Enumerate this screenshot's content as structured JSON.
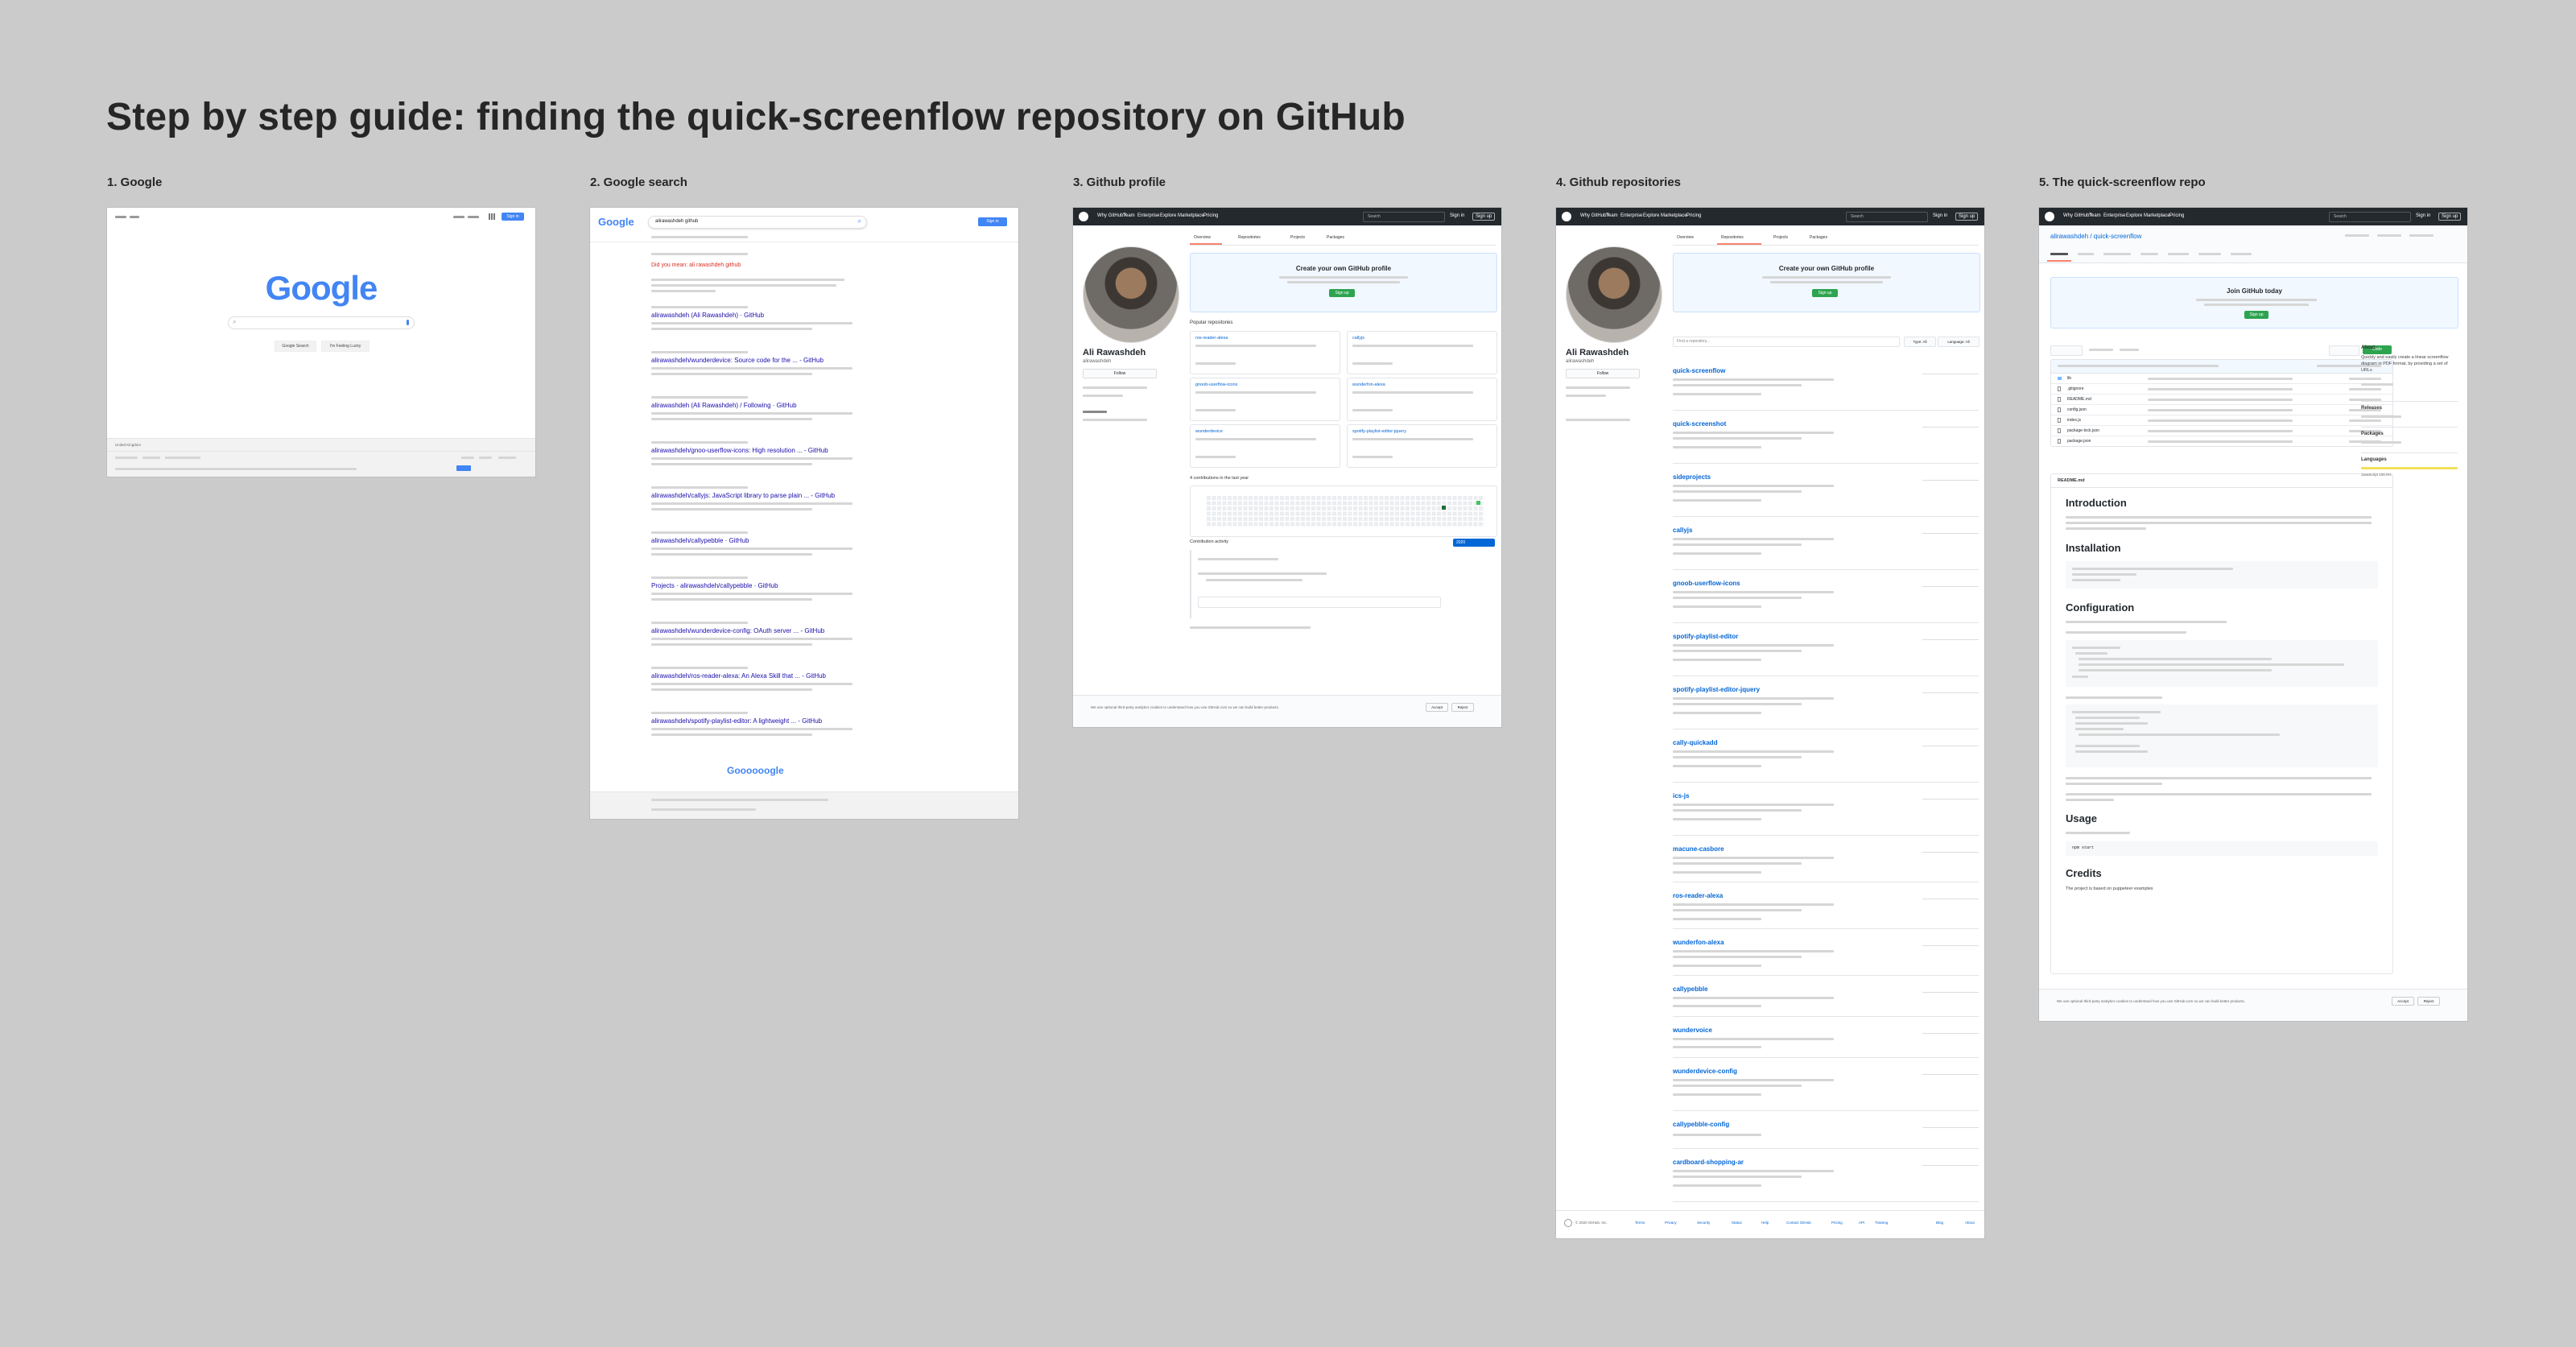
{
  "guide_title": "Step by step guide: finding the quick-screenflow repository on GitHub",
  "steps": [
    {
      "label": "1. Google"
    },
    {
      "label": "2. Google search"
    },
    {
      "label": "3. Github profile"
    },
    {
      "label": "4. Github repositories"
    },
    {
      "label": "5. The quick-screenflow repo"
    }
  ],
  "google_home": {
    "logo": "Google",
    "search_button": "Google Search",
    "lucky_button": "I'm Feeling Lucky",
    "sign_in": "Sign in",
    "location": "United Kingdom"
  },
  "google_search": {
    "logo": "Google",
    "query": "alirawashdeh github",
    "sign_in": "Sign in",
    "did_you_mean": "Did you mean: ali rawashdeh github",
    "results": [
      "alirawashdeh (Ali Rawashdeh) · GitHub",
      "alirawashdeh/wunderdevice: Source code for the ... - GitHub",
      "alirawashdeh (Ali Rawashdeh) / Following · GitHub",
      "alirawashdeh/gnoo-userflow-icons: High resolution ... - GitHub",
      "alirawashdeh/callyjs: JavaScript library to parse plain ... - GitHub",
      "alirawashdeh/callypebble · GitHub",
      "Projects · alirawashdeh/callypebble · GitHub",
      "alirawashdeh/wunderdevice-config: OAuth server ... - GitHub",
      "alirawashdeh/ros-reader-alexa: An Alexa Skill that ... - GitHub",
      "alirawashdeh/spotify-playlist-editor: A lightweight ... - GitHub"
    ],
    "pager": "Goooooogle"
  },
  "github_profile": {
    "name": "Ali Rawashdeh",
    "username": "alirawashdeh",
    "follow": "Follow",
    "banner_title": "Create your own GitHub profile",
    "banner_button": "Sign up",
    "popular_heading": "Popular repositories",
    "popular": [
      "ros-reader-alexa",
      "callyjs",
      "gnoob-userflow-icons",
      "wunderfon-alexa",
      "wunderdevice",
      "spotify-playlist-editor-jquery"
    ],
    "contrib_heading": "4 contributions in the last year",
    "activity_heading": "Contribution activity",
    "tabs": [
      "Overview",
      "Repositories",
      "Projects",
      "Packages"
    ],
    "nav": [
      "Why GitHub?",
      "Team",
      "Enterprise",
      "Explore",
      "Marketplace",
      "Pricing"
    ],
    "search": "Search",
    "sign_in": "Sign in",
    "sign_up": "Sign up",
    "year": "2020",
    "cookie": "We use optional third-party analytics cookies to understand how you use GitHub.com so we can build better products.",
    "accept": "Accept",
    "reject": "Reject"
  },
  "github_repos": {
    "name": "Ali Rawashdeh",
    "username": "alirawashdeh",
    "follow": "Follow",
    "banner_title": "Create your own GitHub profile",
    "banner_button": "Sign up",
    "find_placeholder": "Find a repository...",
    "type": "Type: All",
    "language": "Language: All",
    "repos": [
      "quick-screenflow",
      "quick-screenshot",
      "sideprojects",
      "callyjs",
      "gnoob-userflow-icons",
      "spotify-playlist-editor",
      "spotify-playlist-editor-jquery",
      "cally-quickadd",
      "ics-js",
      "macune-casbore",
      "ros-reader-alexa",
      "wunderfon-alexa",
      "callypebble",
      "wundervoice",
      "wunderdevice-config",
      "callypebble-config",
      "cardboard-shopping-ar"
    ],
    "footer": "© 2020 GitHub, Inc.",
    "footer_links": [
      "Terms",
      "Privacy",
      "Security",
      "Status",
      "Help",
      "Contact GitHub",
      "Pricing",
      "API",
      "Training",
      "Blog",
      "About"
    ]
  },
  "github_repo": {
    "repo_path": "alirawashdeh / quick-screenflow",
    "join_title": "Join GitHub today",
    "join_button": "Sign up",
    "about_heading": "About",
    "about_text": "Quickly and easily create a linear screenflow diagram in PDF format, by providing a set of URLs",
    "releases": "Releases",
    "packages": "Packages",
    "languages": "Languages",
    "language": "JavaScript 100.0%",
    "files": [
      "lib",
      ".gitignore",
      "README.md",
      "config.json",
      "index.js",
      "package-lock.json",
      "package.json"
    ],
    "readme_file": "README.md",
    "sections": [
      "Introduction",
      "Installation",
      "Configuration",
      "Usage",
      "Credits"
    ],
    "credits_text": "The project is based on puppeteer examples",
    "code_button": "Code",
    "usage_code": "npm start"
  }
}
